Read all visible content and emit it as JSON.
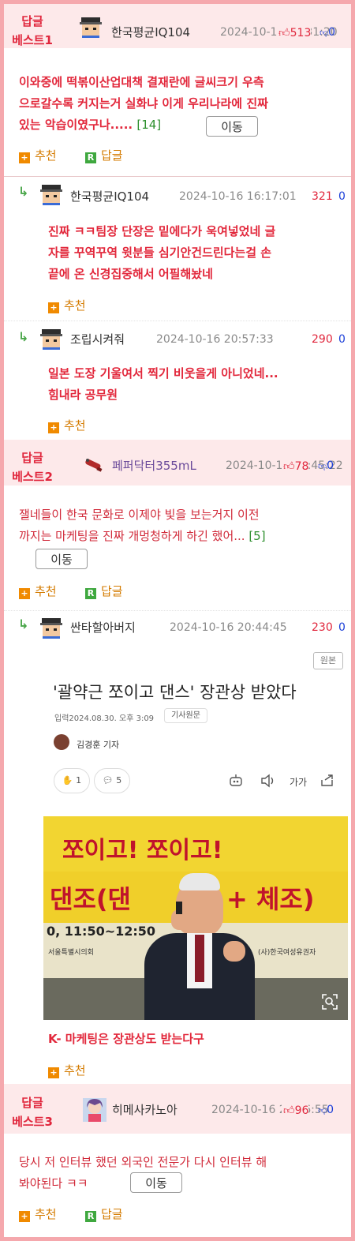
{
  "colors": {
    "accent": "#e2273b",
    "frame": "#f5a8ad",
    "best_bg": "#fde9ea",
    "up": "#e0263c",
    "down": "#1b3fd8",
    "reply_green": "#4aa64a",
    "action_orange": "#f08a00"
  },
  "best1": {
    "label_line1": "답글",
    "label_line2": "베스트1",
    "nickname": "한국평균IQ104",
    "date": "2024-10-16 15:31:20",
    "up": "513",
    "down": "0",
    "body_line1": "이와중에 떡볶이산업대책 결재란에 글씨크기 우측",
    "body_line2": "으로갈수록 커지는거 실화냐 이게 우리나라에 진짜",
    "body_line3": "있는 악습이였구나.....",
    "reply_count": "[14]",
    "move_label": "이동",
    "recommend_label": "추천",
    "reply_label": "답글",
    "replies": [
      {
        "nickname": "한국평균IQ104",
        "date": "2024-10-16 16:17:01",
        "up": "321",
        "down": "0",
        "lines": [
          "진짜 ㅋㅋ팀장 단장은 밑에다가 욱여넣었네 글",
          "자를 꾸역꾸역 윗분들 심기안건드린다는걸 손",
          "끝에 온 신경집중해서 어필해놨네"
        ],
        "recommend_label": "추천"
      },
      {
        "nickname": "조립시켜줘",
        "date": "2024-10-16 20:57:33",
        "up": "290",
        "down": "0",
        "lines": [
          "일본 도장 기울여서 찍기 비웃을게 아니었네...",
          "힘내라 공무원"
        ],
        "recommend_label": "추천"
      }
    ]
  },
  "best2": {
    "label_line1": "답글",
    "label_line2": "베스트2",
    "nickname": "페퍼닥터355mL",
    "date": "2024-10-16 13:45:22",
    "up": "78",
    "down": "0",
    "body_line1": "잴네들이 한국 문화로 이제야 빛을 보는거지 이전",
    "body_line2": "까지는 마케팅을 진짜 개멍청하게 하긴 했어...",
    "reply_count": "[5]",
    "move_label": "이동",
    "recommend_label": "추천",
    "reply_label": "답글",
    "reply": {
      "nickname": "싼타할아버지",
      "date": "2024-10-16 20:44:45",
      "up": "230",
      "down": "0",
      "article": {
        "origin_label": "원본",
        "title": "'괄약근 쪼이고 댄스' 장관상 받았다",
        "meta": "입력2024.08.30. 오후 3:09",
        "meta_badge": "기사원문",
        "reporter": "김경훈 기자",
        "like_count": "1",
        "comment_count": "5",
        "font_label": "가가",
        "banner_top": "쪼이고! 쪼이고!",
        "banner_main": "댄조(댄",
        "banner_right": "+ 체조)",
        "banner_time": "0, 11:50~12:50",
        "banner_org1": "서울특별시의회",
        "banner_org2": "(사)한국여성유권자"
      },
      "caption": "K- 마케팅은 장관상도 받는다구",
      "recommend_label": "추천"
    }
  },
  "best3": {
    "label_line1": "답글",
    "label_line2": "베스트3",
    "nickname": "히메사카노아",
    "date": "2024-10-16 21:06:55",
    "up": "96",
    "down": "0",
    "body_line1": "당시 저 인터뷰 했던 외국인 전문가 다시 인터뷰 해",
    "body_line2": "봐야된다 ㅋㅋ",
    "move_label": "이동",
    "recommend_label": "추천",
    "reply_label": "답글"
  },
  "icons": [
    "thumb-up-icon",
    "thumb-down-icon",
    "reply-arrow-icon",
    "plus-box-icon",
    "reply-box-icon",
    "robot-icon",
    "speaker-icon",
    "share-icon",
    "zoom-icon"
  ]
}
